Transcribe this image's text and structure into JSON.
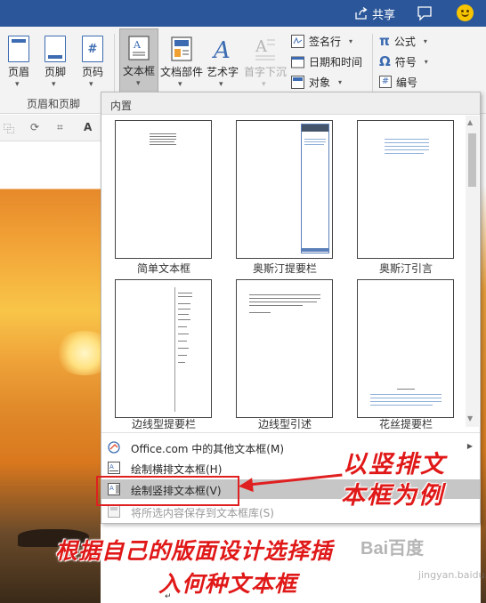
{
  "topbar": {
    "share_label": "共享",
    "share_icon": "share-icon",
    "comment_icon": "comment-icon",
    "feedback_icon": "smiley-icon",
    "color": "#2b579a"
  },
  "ribbon": {
    "header_footer": {
      "buttons": [
        {
          "label": "页眉",
          "icon": "header-icon"
        },
        {
          "label": "页脚",
          "icon": "footer-icon"
        },
        {
          "label": "页码",
          "icon": "page-number-icon"
        }
      ],
      "group_label": "页眉和页脚"
    },
    "text": {
      "buttons": [
        {
          "label": "文本框",
          "icon": "textbox-icon",
          "active": true
        },
        {
          "label": "文档部件",
          "icon": "quick-parts-icon"
        },
        {
          "label": "艺术字",
          "icon": "wordart-icon"
        },
        {
          "label": "首字下沉",
          "icon": "drop-cap-icon",
          "disabled": true
        }
      ],
      "small": [
        {
          "label": "签名行",
          "icon": "signature-line-icon"
        },
        {
          "label": "日期和时间",
          "icon": "date-time-icon"
        },
        {
          "label": "对象",
          "icon": "object-icon"
        }
      ]
    },
    "symbols": {
      "small": [
        {
          "label": "公式",
          "glyph": "π",
          "icon": "equation-icon"
        },
        {
          "label": "符号",
          "glyph": "Ω",
          "icon": "symbol-icon"
        },
        {
          "label": "编号",
          "glyph": "#",
          "icon": "number-icon"
        }
      ]
    }
  },
  "subtoolbar": {
    "icons": [
      "shapes-icon",
      "rotate-icon",
      "crop-icon"
    ],
    "letter": "A"
  },
  "gallery": {
    "header": "内置",
    "items": [
      {
        "label": "简单文本框"
      },
      {
        "label": "奥斯汀提要栏"
      },
      {
        "label": "奥斯汀引言"
      },
      {
        "label": "边线型提要栏"
      },
      {
        "label": "边线型引述"
      },
      {
        "label": "花丝提要栏"
      }
    ],
    "menu": [
      {
        "label": "Office.com 中的其他文本框(M)",
        "icon": "office-icon",
        "has_submenu": true
      },
      {
        "label": "绘制横排文本框(H)",
        "icon": "horizontal-textbox-icon"
      },
      {
        "label": "绘制竖排文本框(V)",
        "icon": "vertical-textbox-icon",
        "highlighted": true
      },
      {
        "label": "将所选内容保存到文本框库(S)",
        "icon": "save-selection-icon",
        "disabled": true
      }
    ]
  },
  "annotations": {
    "callout_line1": "以竖排文",
    "callout_line2": "本框为例",
    "bottom_line1": "根据自己的版面设计选择插",
    "bottom_line2": "入何种文本框",
    "color": "#e01818"
  },
  "watermark": {
    "text": "Bai百度",
    "sub": "jingyan.baidu.com"
  }
}
